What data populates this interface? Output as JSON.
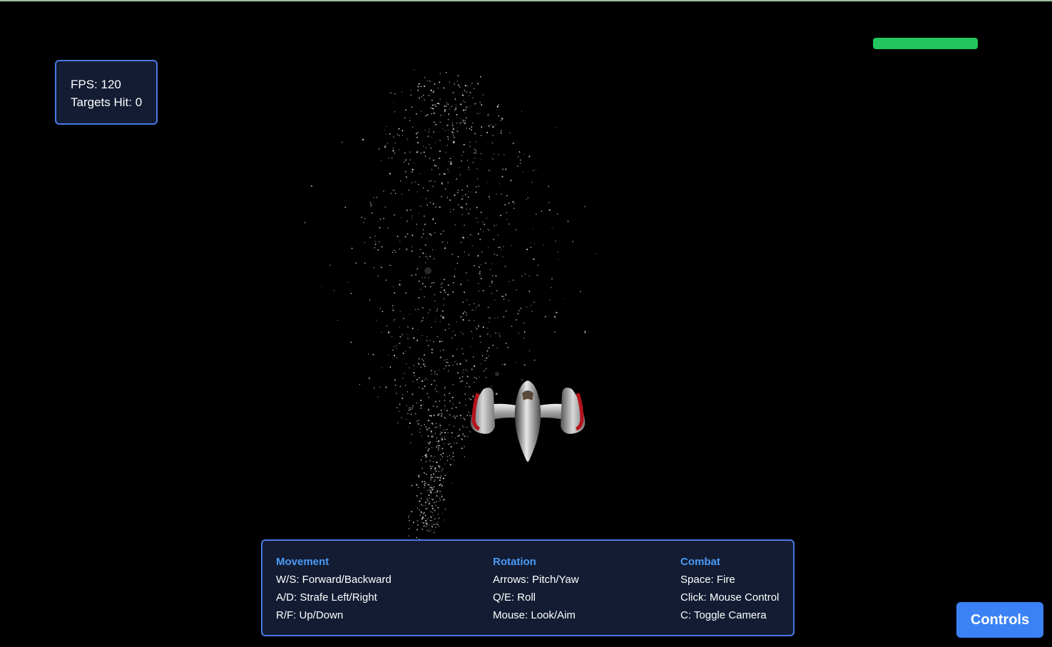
{
  "hud": {
    "fps_text": "FPS: 120",
    "targets_text": "Targets Hit: 0",
    "health_fraction": 1.0,
    "health_color": "#22c55e"
  },
  "controls": {
    "movement": {
      "title": "Movement",
      "lines": [
        "W/S: Forward/Backward",
        "A/D: Strafe Left/Right",
        "R/F: Up/Down"
      ]
    },
    "rotation": {
      "title": "Rotation",
      "lines": [
        "Arrows: Pitch/Yaw",
        "Q/E: Roll",
        "Mouse: Look/Aim"
      ]
    },
    "combat": {
      "title": "Combat",
      "lines": [
        "Space: Fire",
        "Click: Mouse Control",
        "C: Toggle Camera"
      ]
    }
  },
  "controls_button_label": "Controls",
  "colors": {
    "panel_bg": "#131c33",
    "panel_border": "#4a78e8",
    "heading": "#4b9bf5",
    "button": "#3b82f6",
    "ship_accent": "#b3121b"
  }
}
